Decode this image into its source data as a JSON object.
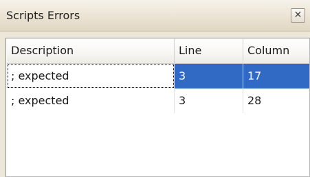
{
  "window": {
    "title": "Scripts Errors",
    "close_glyph": "✕",
    "close_icon": "close-icon"
  },
  "table": {
    "columns": [
      "Description",
      "Line",
      "Column"
    ],
    "rows": [
      {
        "description": "; expected",
        "line": "3",
        "column": "17",
        "selected": true
      },
      {
        "description": "; expected",
        "line": "3",
        "column": "28",
        "selected": false
      }
    ]
  },
  "colors": {
    "selection": "#316ac5",
    "panel_background": "#ede7da"
  }
}
